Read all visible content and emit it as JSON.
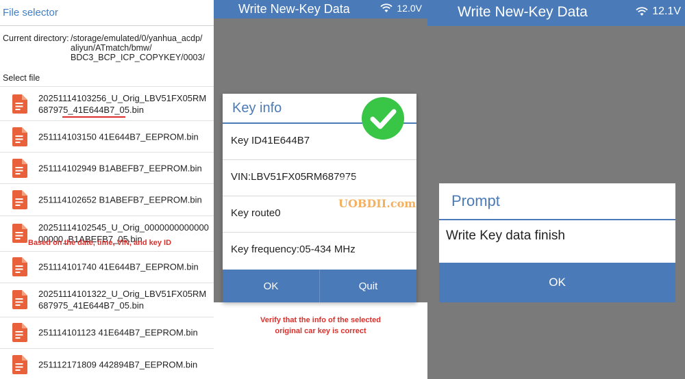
{
  "file_selector": {
    "title": "File selector",
    "current_dir_label": "Current directory:",
    "current_dir_path": "/storage/emulated/0/yanhua_acdp/\naliyun/ATmatch/bmw/\nBDC3_BCP_ICP_COPYKEY/0003/",
    "select_label": "Select file",
    "files": [
      "20251114103256_U_Orig_LBV51FX05RM687975_41E644B7_05.bin",
      "251114103150 41E644B7_EEPROM.bin",
      "251114102949 B1ABEFB7_EEPROM.bin",
      "251114102652 B1ABEFB7_EEPROM.bin",
      "20251114102545_U_Orig_000000000000000000_B1ABEFB7_05.bin",
      "251114101740 41E644B7_EEPROM.bin",
      "20251114101322_U_Orig_LBV51FX05RM687975_41E644B7_05.bin",
      "251114101123 41E644B7_EEPROM.bin",
      "251112171809 442894B7_EEPROM.bin"
    ],
    "annotation": "Based on the date, time, VIN, and key ID"
  },
  "screen2": {
    "title": "Write New-Key Data",
    "voltage": "12.0V",
    "dialog_title": "Key info",
    "key_id": "Key ID41E644B7",
    "vin": "VIN:LBV51FX05RM687975",
    "key_route": "Key route0",
    "key_frequency": "Key frequency:05-434 MHz",
    "ok_label": "OK",
    "quit_label": "Quit",
    "annotation_line1": "Verify that the info of the selected",
    "annotation_line2": "original car key is correct",
    "watermark": "OBD2",
    "watermark2": "UOBDII.com"
  },
  "screen3": {
    "title": "Write New-Key Data",
    "voltage": "12.1V",
    "dialog_title": "Prompt",
    "message": "Write Key data finish",
    "ok_label": "OK"
  },
  "colors": {
    "accent": "#4a7ab7",
    "annotation_red": "#d9302c",
    "file_icon": "#e9613b",
    "check_green": "#39c546"
  }
}
